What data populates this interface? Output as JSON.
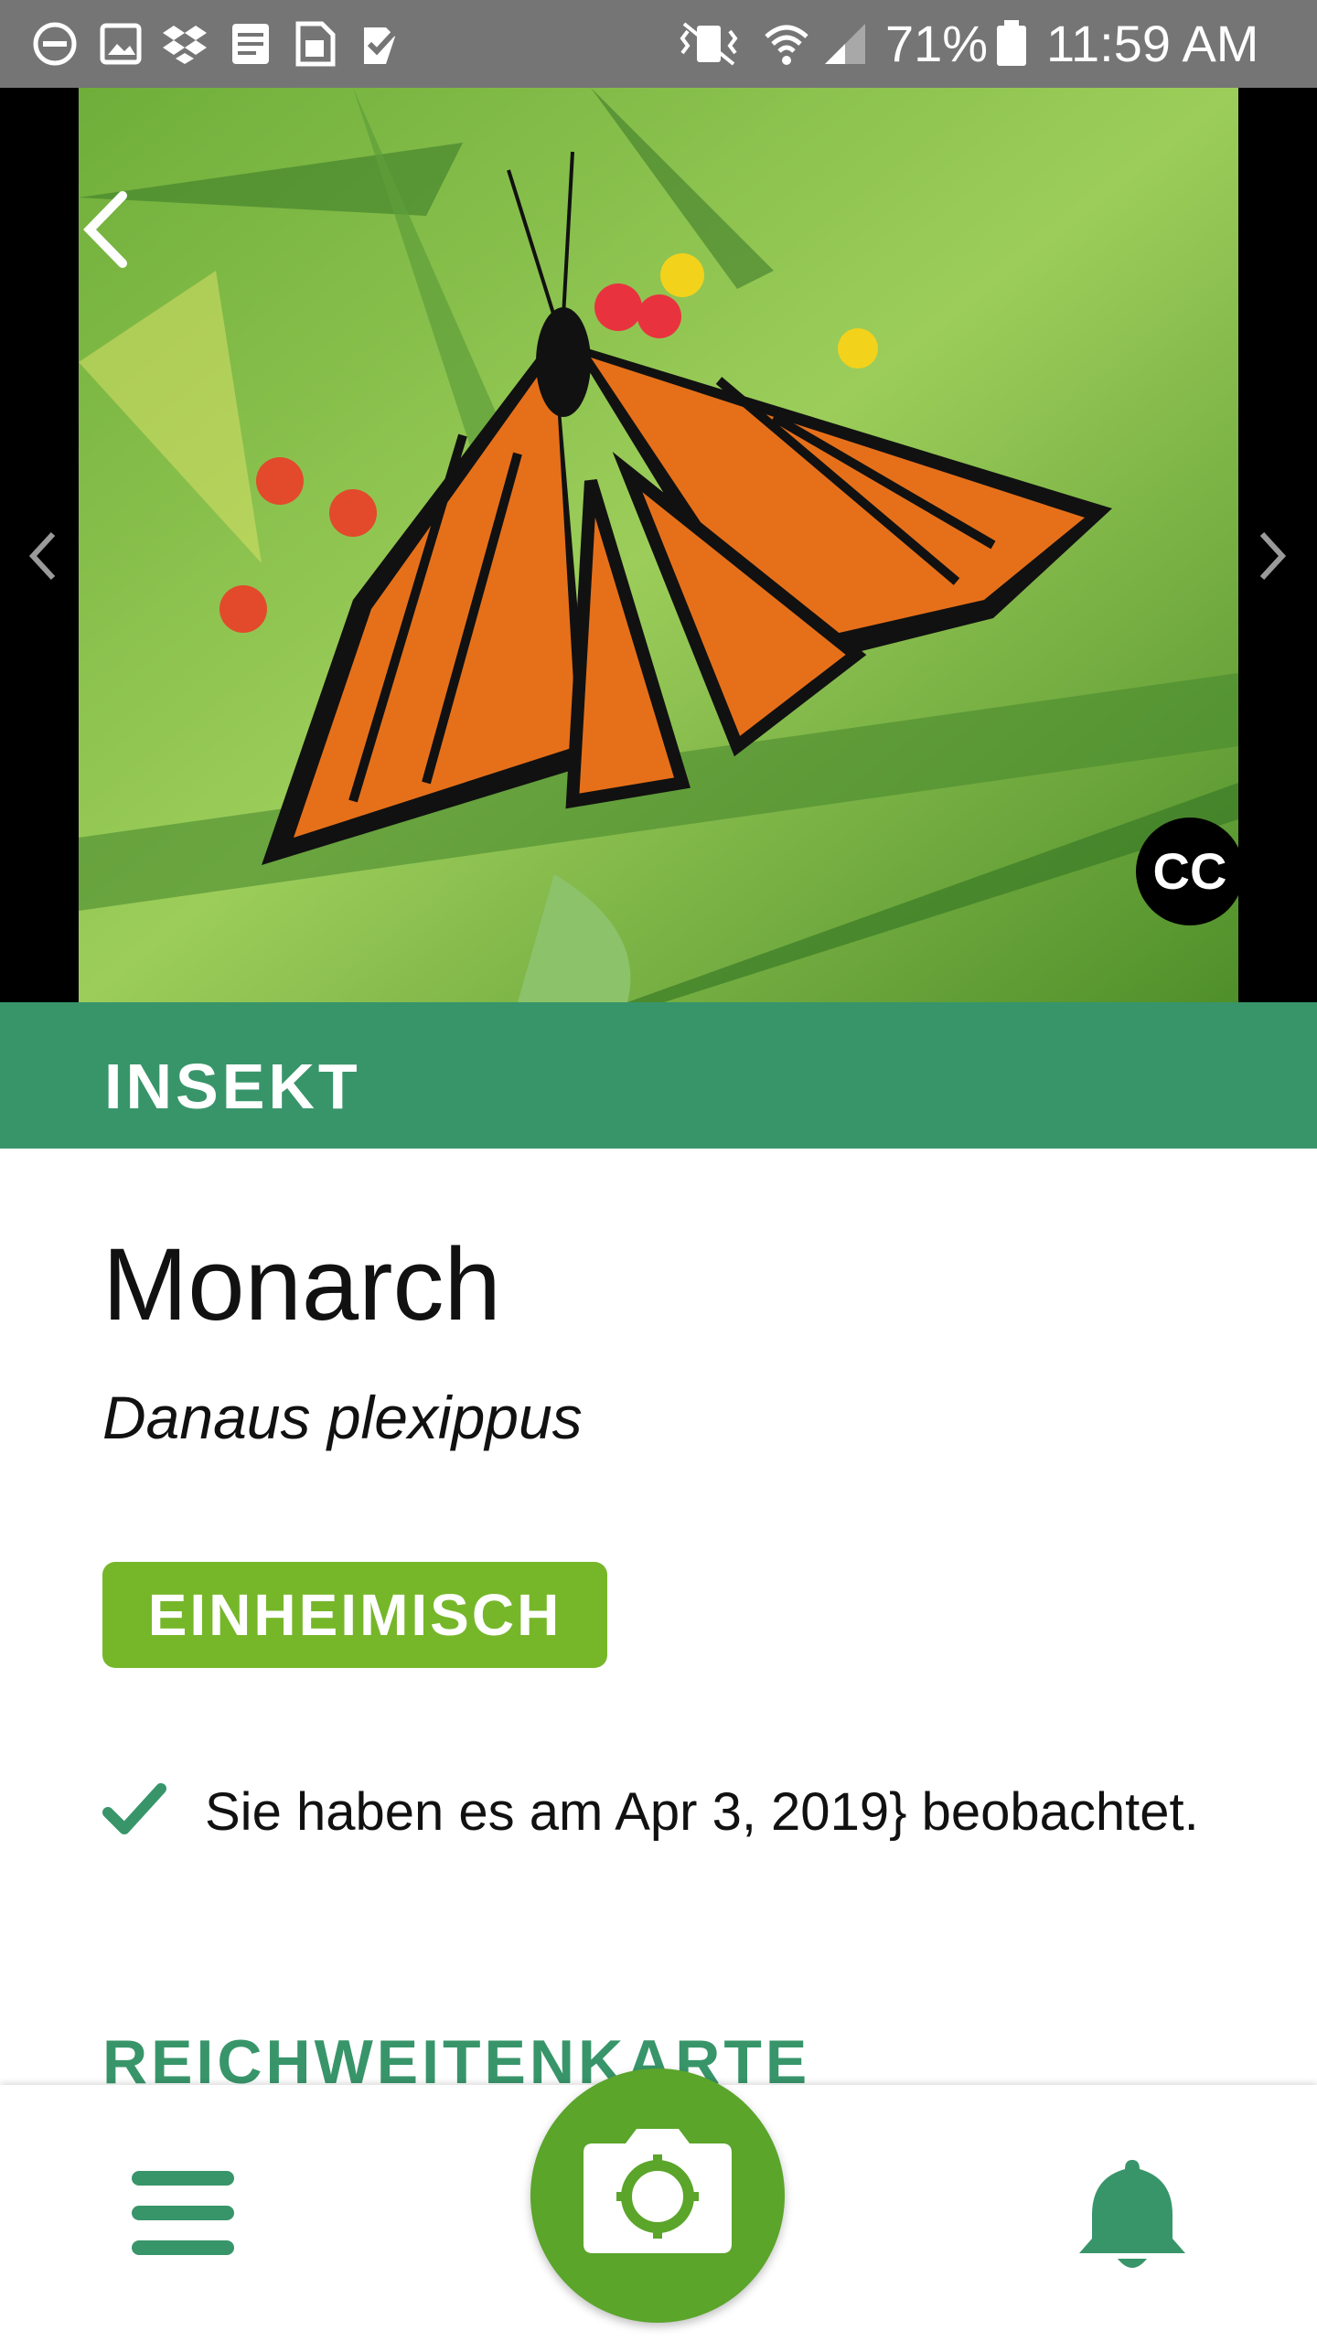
{
  "status_bar": {
    "battery_percent": "71%",
    "time": "11:59 AM",
    "icons": [
      "do-not-disturb-icon",
      "gallery-icon",
      "dropbox-icon",
      "notes-icon",
      "sim-icon",
      "tasks-icon",
      "vibrate-icon",
      "wifi-icon",
      "signal-icon",
      "battery-icon"
    ]
  },
  "species": {
    "category": "INSEKT",
    "common_name": "Monarch",
    "scientific_name": "Danaus plexippus",
    "status_badge": "EINHEIMISCH",
    "observed_text": "Sie haben es am Apr 3, 2019} beobachtet.",
    "photo_license": "CC"
  },
  "sections": {
    "range_map_heading": "REICHWEITENKARTE"
  },
  "bottom_nav": {
    "icons": [
      "menu-icon",
      "camera-icon",
      "bell-icon"
    ]
  },
  "colors": {
    "accent_green": "#38956a",
    "native_badge": "#76b72a",
    "camera_button": "#5aa52a",
    "status_bar": "#757575"
  }
}
